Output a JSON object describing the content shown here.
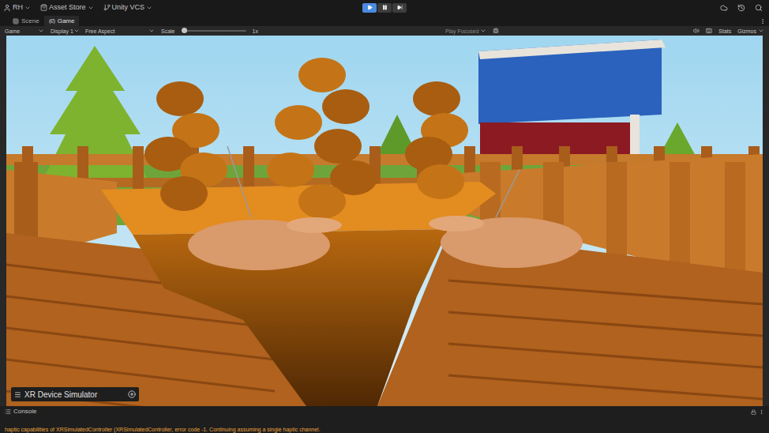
{
  "top_bar": {
    "account": "RH",
    "asset_store": "Asset Store",
    "vcs": "Unity VCS"
  },
  "play_controls": [
    {
      "kind": "play",
      "active": true
    },
    {
      "kind": "pause",
      "active": false
    },
    {
      "kind": "step",
      "active": false
    }
  ],
  "tabs": [
    {
      "label": "Scene",
      "selected": false
    },
    {
      "label": "Game",
      "selected": true
    }
  ],
  "game_toolbar": {
    "view": "Game",
    "display": "Display 1",
    "aspect": "Free Aspect",
    "scale_label": "Scale",
    "scale_level": 0,
    "scale_value": "1x",
    "play_mode": "Play Focused",
    "stats": "Stats",
    "gizmos": "Gizmos"
  },
  "overlay": {
    "title": "XR Device Simulator"
  },
  "console": {
    "title": "Console",
    "message": "haptic capabilities of XRSimulatedController (XRSimulatedController, error code -1. Continuing assuming a single haptic channel."
  }
}
